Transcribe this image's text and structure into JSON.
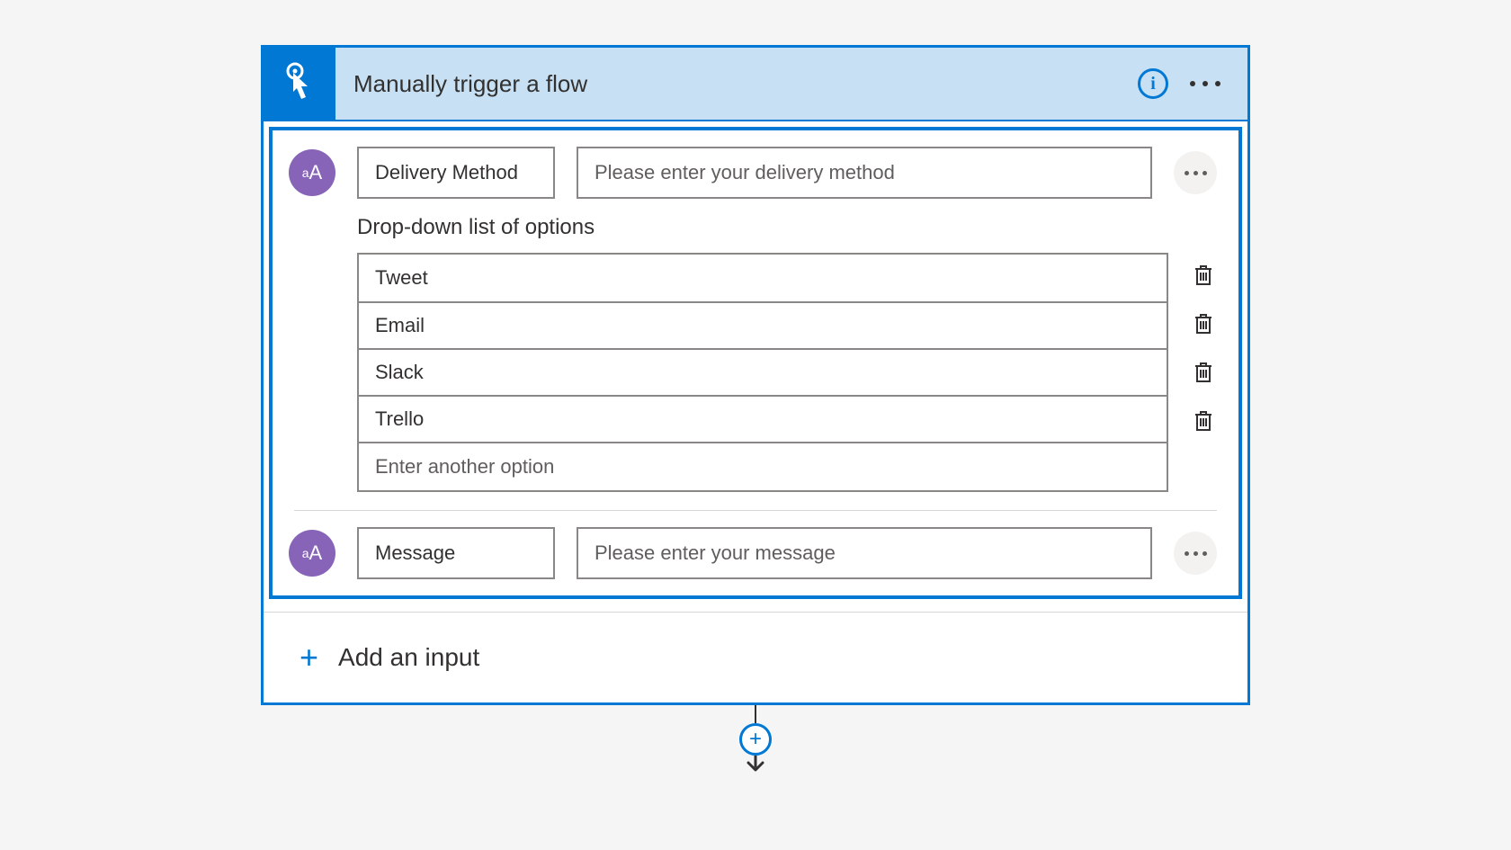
{
  "card": {
    "title": "Manually trigger a flow",
    "icon": "touch-pointer-icon"
  },
  "inputs": [
    {
      "type_label": "aA",
      "name": "Delivery Method",
      "description": "Please enter your delivery method",
      "dropdown": {
        "label": "Drop-down list of options",
        "options": [
          "Tweet",
          "Email",
          "Slack",
          "Trello"
        ],
        "add_placeholder": "Enter another option"
      }
    },
    {
      "type_label": "aA",
      "name": "Message",
      "description": "Please enter your message"
    }
  ],
  "add_input_label": "Add an input"
}
